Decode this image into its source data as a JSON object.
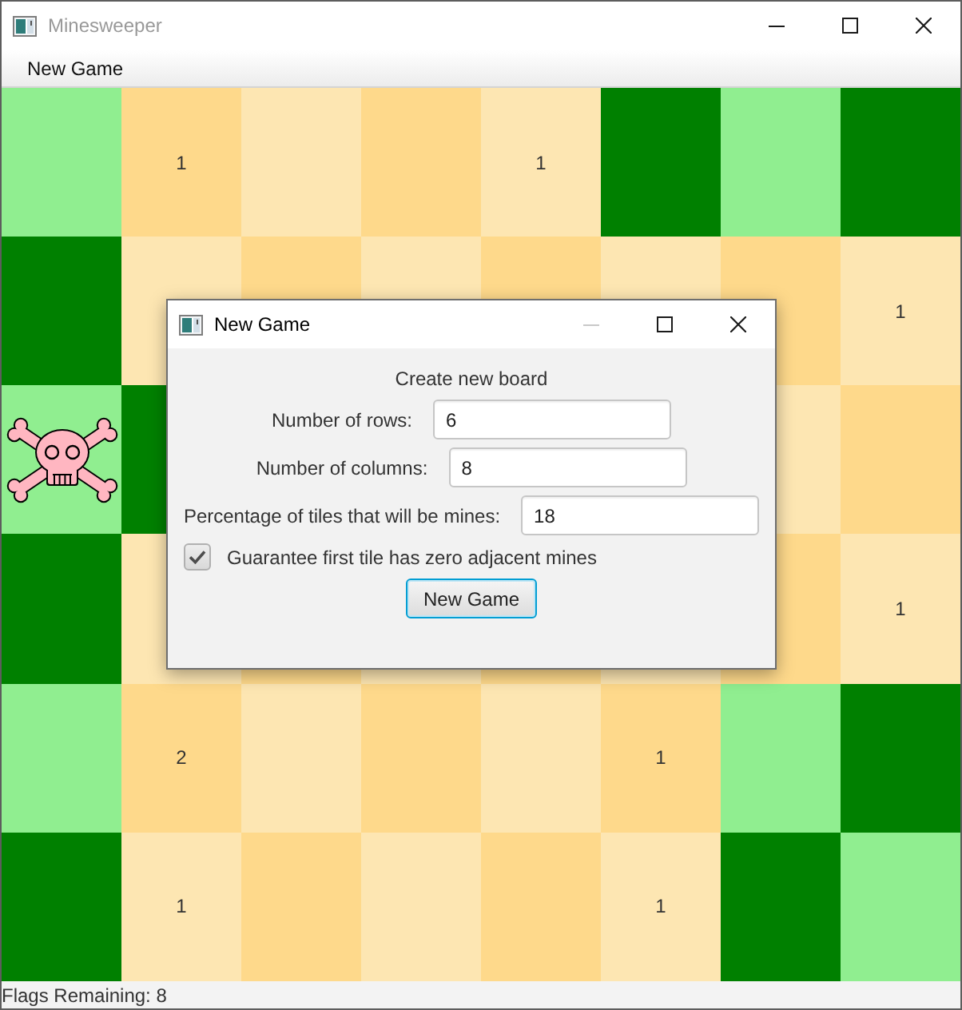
{
  "window": {
    "title": "Minesweeper",
    "active": false,
    "controls": [
      {
        "kind": "minimize",
        "disabled": false
      },
      {
        "kind": "maximize",
        "disabled": false
      },
      {
        "kind": "close",
        "disabled": false
      }
    ]
  },
  "menu_bar": {
    "items": [
      "New Game"
    ]
  },
  "board": {
    "rows": [
      [
        {
          "kind": "covered"
        },
        {
          "kind": "revealed",
          "number": "1"
        },
        {
          "kind": "revealed"
        },
        {
          "kind": "revealed"
        },
        {
          "kind": "revealed",
          "number": "1"
        },
        {
          "kind": "covered"
        },
        {
          "kind": "covered"
        },
        {
          "kind": "covered"
        }
      ],
      [
        {
          "kind": "covered"
        },
        {
          "kind": "revealed"
        },
        {
          "kind": "revealed"
        },
        {
          "kind": "revealed"
        },
        {
          "kind": "revealed"
        },
        {
          "kind": "revealed"
        },
        {
          "kind": "revealed"
        },
        {
          "kind": "revealed",
          "number": "1"
        }
      ],
      [
        {
          "kind": "mine"
        },
        {
          "kind": "covered"
        },
        null,
        null,
        null,
        null,
        {
          "kind": "revealed"
        },
        {
          "kind": "revealed"
        }
      ],
      [
        {
          "kind": "covered"
        },
        {
          "kind": "revealed"
        },
        {
          "kind": "revealed"
        },
        {
          "kind": "revealed"
        },
        {
          "kind": "revealed"
        },
        {
          "kind": "revealed"
        },
        {
          "kind": "revealed"
        },
        {
          "kind": "revealed",
          "number": "1"
        }
      ],
      [
        {
          "kind": "covered"
        },
        {
          "kind": "revealed",
          "number": "2"
        },
        {
          "kind": "revealed"
        },
        {
          "kind": "revealed"
        },
        {
          "kind": "revealed"
        },
        {
          "kind": "revealed",
          "number": "1"
        },
        {
          "kind": "covered"
        },
        {
          "kind": "covered"
        }
      ],
      [
        {
          "kind": "covered"
        },
        {
          "kind": "revealed",
          "number": "1"
        },
        {
          "kind": "revealed"
        },
        {
          "kind": "revealed"
        },
        {
          "kind": "revealed"
        },
        {
          "kind": "revealed",
          "number": "1"
        },
        {
          "kind": "covered"
        },
        {
          "kind": "covered"
        }
      ]
    ]
  },
  "status_bar": {
    "text": "Flags Remaining: 8"
  },
  "dialog": {
    "title": "New Game",
    "active": true,
    "controls": [
      {
        "kind": "minimize",
        "disabled": true
      },
      {
        "kind": "maximize",
        "disabled": false
      },
      {
        "kind": "close",
        "disabled": false
      }
    ],
    "heading": "Create new board",
    "fields": [
      {
        "label": "Number of rows:",
        "value": "6"
      },
      {
        "label": "Number of columns:",
        "value": "8"
      },
      {
        "label": "Percentage of tiles that will be mines:",
        "value": "18"
      }
    ],
    "checkbox": {
      "label": "Guarantee first tile has zero adjacent mines",
      "checked": true
    },
    "button": {
      "label": "New Game",
      "focused": true
    }
  }
}
